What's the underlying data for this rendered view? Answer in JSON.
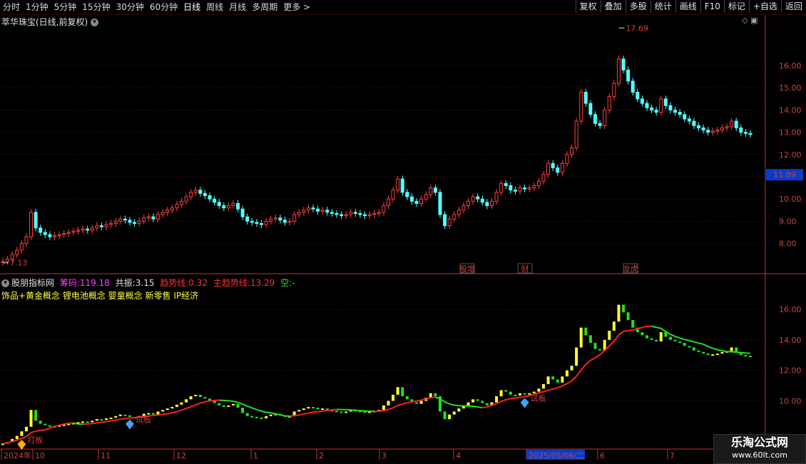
{
  "toolbar": {
    "periods": [
      "分时",
      "1分钟",
      "5分钟",
      "15分钟",
      "30分钟",
      "60分钟",
      "日线",
      "周线",
      "月线",
      "多周期",
      "更多 >"
    ],
    "active": "日线",
    "actions": [
      "复权",
      "叠加",
      "多股",
      "统计",
      "画线",
      "F10",
      "标记",
      "+自选",
      "返回"
    ]
  },
  "main_panel": {
    "title": "萃华珠宝(日线,前复权)",
    "high_label": "17.69",
    "low_label": "7.13",
    "price_ticks": [
      "16.00",
      "15.00",
      "14.00",
      "13.00",
      "12.00",
      "11.00",
      "10.00",
      "9.00",
      "8.00"
    ],
    "current_price": "11.09",
    "events": [
      "股增",
      "财",
      "龙虎"
    ]
  },
  "indicator_panel": {
    "name": "股朋指标网",
    "chouma_label": "筹码:",
    "chouma_value": "119.18",
    "gongzhen_label": "共振:",
    "gongzhen_value": "3.15",
    "trend_label": "趋势线:",
    "trend_value": "0.32",
    "main_trend_label": "主趋势线:",
    "main_trend_value": "13.29",
    "kong_label": "空:",
    "kong_value": "-",
    "concepts": "饰品+黄金概念 锂电池概念 婴童概念 新零售 IP经济",
    "ticks": [
      "16.00",
      "14.00",
      "12.00",
      "10.00"
    ],
    "signals": [
      "打板",
      "试板",
      "试板"
    ]
  },
  "time_axis": {
    "labels": [
      "2024年",
      "10",
      "11",
      "12",
      "1",
      "2",
      "3",
      "4",
      "2025/05/06/二",
      "6",
      "7"
    ]
  },
  "colors": {
    "up": "#ff4040",
    "down": "#54ffff",
    "axis": "#c83232",
    "ma_up": "#ff2020",
    "ma_down": "#20e020",
    "bar_up": "#ffff30",
    "bar_down": "#20e020"
  },
  "watermark": {
    "line1": "乐淘公式网",
    "line2": "www.60lt.com"
  },
  "chart_data": {
    "type": "candlestick",
    "price_range": [
      7.13,
      17.69
    ],
    "indicator_ylim": [
      8.5,
      17.5
    ],
    "closes": [
      7.2,
      7.3,
      7.5,
      7.7,
      8.0,
      8.3,
      9.4,
      8.7,
      8.5,
      8.4,
      8.3,
      8.35,
      8.4,
      8.45,
      8.5,
      8.55,
      8.6,
      8.65,
      8.6,
      8.7,
      8.8,
      8.75,
      8.85,
      8.9,
      9.0,
      9.1,
      9.05,
      8.95,
      8.9,
      9.0,
      9.15,
      9.2,
      9.1,
      9.3,
      9.4,
      9.5,
      9.6,
      9.75,
      9.9,
      10.1,
      10.3,
      10.4,
      10.25,
      10.15,
      10.0,
      9.85,
      9.7,
      9.6,
      9.7,
      9.8,
      9.55,
      9.2,
      9.0,
      8.95,
      8.9,
      8.85,
      9.0,
      9.1,
      9.15,
      9.05,
      8.95,
      9.0,
      9.3,
      9.4,
      9.5,
      9.6,
      9.55,
      9.45,
      9.5,
      9.4,
      9.35,
      9.3,
      9.25,
      9.3,
      9.4,
      9.35,
      9.3,
      9.25,
      9.3,
      9.35,
      9.4,
      9.7,
      10.0,
      10.4,
      10.9,
      10.3,
      10.1,
      9.9,
      9.8,
      10.0,
      10.2,
      10.5,
      10.3,
      9.3,
      8.8,
      9.1,
      9.3,
      9.5,
      9.7,
      9.9,
      10.1,
      10.0,
      9.85,
      9.7,
      9.9,
      10.3,
      10.7,
      10.6,
      10.4,
      10.35,
      10.5,
      10.45,
      10.5,
      10.6,
      10.8,
      11.1,
      11.6,
      11.4,
      11.2,
      11.6,
      12.0,
      12.3,
      13.5,
      14.8,
      14.3,
      13.8,
      13.4,
      13.3,
      14.0,
      14.6,
      15.2,
      16.3,
      15.8,
      15.3,
      14.8,
      14.5,
      14.3,
      14.1,
      14.0,
      13.9,
      14.5,
      14.2,
      14.0,
      13.9,
      13.8,
      13.6,
      13.5,
      13.3,
      13.2,
      13.1,
      13.0,
      13.05,
      13.1,
      13.2,
      13.25,
      13.5,
      13.2,
      13.0,
      12.95,
      12.9
    ]
  }
}
